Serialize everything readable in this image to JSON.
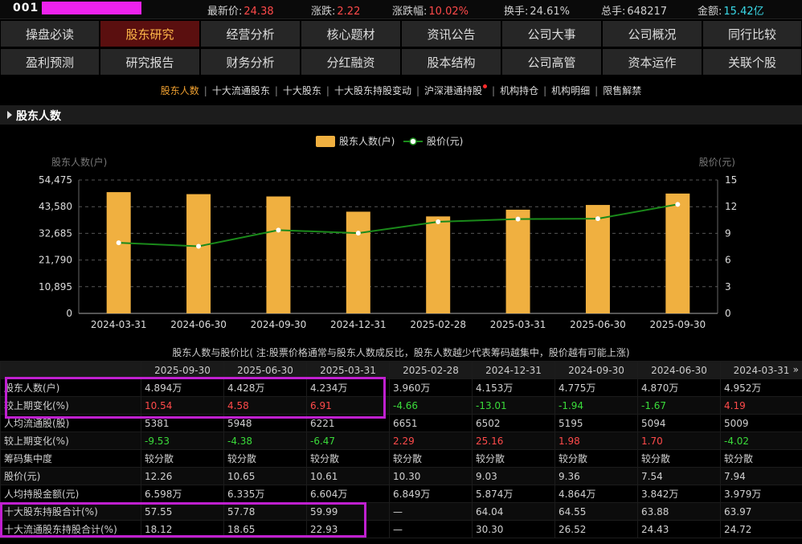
{
  "quote": {
    "code": "001",
    "items": [
      {
        "label": "最新价:",
        "value": "24.38",
        "cls": "val"
      },
      {
        "label": "涨跌:",
        "value": "2.22",
        "cls": "val"
      },
      {
        "label": "涨跌幅:",
        "value": "10.02%",
        "cls": "val"
      },
      {
        "label": "换手:",
        "value": "24.61%",
        "cls": "val nc"
      },
      {
        "label": "总手:",
        "value": "648217",
        "cls": "val nc"
      },
      {
        "label": "金额:",
        "value": "15.42亿",
        "cls": "val cyan"
      }
    ]
  },
  "nav": {
    "row1": [
      "操盘必读",
      "股东研究",
      "经营分析",
      "核心题材",
      "资讯公告",
      "公司大事",
      "公司概况",
      "同行比较"
    ],
    "row2": [
      "盈利预测",
      "研究报告",
      "财务分析",
      "分红融资",
      "股本结构",
      "公司高管",
      "资本运作",
      "关联个股"
    ],
    "active": "股东研究"
  },
  "subtabs": {
    "items": [
      "股东人数",
      "十大流通股东",
      "十大股东",
      "十大股东持股变动",
      "沪深港通持股",
      "机构持仓",
      "机构明细",
      "限售解禁"
    ],
    "active": "股东人数"
  },
  "section": {
    "title": "股东人数"
  },
  "chart_data": {
    "type": "bar+line",
    "categories": [
      "2024-03-31",
      "2024-06-30",
      "2024-09-30",
      "2024-12-31",
      "2025-02-28",
      "2025-03-31",
      "2025-06-30",
      "2025-09-30"
    ],
    "series": [
      {
        "name": "股东人数(户)",
        "type": "bar",
        "axis": "left",
        "values": [
          49520,
          48700,
          47750,
          41530,
          39600,
          42340,
          44280,
          48940
        ],
        "color": "#f0b040"
      },
      {
        "name": "股价(元)",
        "type": "line",
        "axis": "right",
        "values": [
          7.94,
          7.54,
          9.36,
          9.03,
          10.3,
          10.61,
          10.65,
          12.26
        ],
        "color": "#1a8a1a"
      }
    ],
    "ylabel_left": "股东人数(户)",
    "ylabel_right": "股价(元)",
    "yticks_left": [
      "54,475",
      "43,580",
      "32,685",
      "21,790",
      "10,895",
      "0"
    ],
    "yticks_right": [
      "15",
      "12",
      "9",
      "6",
      "3",
      "0"
    ],
    "ylim_left": [
      0,
      54475
    ],
    "ylim_right": [
      0,
      15
    ],
    "grid": true,
    "legend_position": "top-center"
  },
  "table": {
    "caption": "股东人数与股价比( 注:股票价格通常与股东人数成反比，股东人数越少代表筹码越集中，股价越有可能上涨)",
    "headers": [
      "",
      "2025-09-30",
      "2025-06-30",
      "2025-03-31",
      "2025-02-28",
      "2024-12-31",
      "2024-09-30",
      "2024-06-30",
      "2024-03-31"
    ],
    "more": "»",
    "rows": [
      {
        "label": "股东人数(户)",
        "cells": [
          "4.894万",
          "4.428万",
          "4.234万",
          "3.960万",
          "4.153万",
          "4.775万",
          "4.870万",
          "4.952万"
        ],
        "colors": [
          "nc",
          "nc",
          "nc",
          "nc",
          "nc",
          "nc",
          "nc",
          "nc"
        ]
      },
      {
        "label": "较上期变化(%)",
        "cells": [
          "10.54",
          "4.58",
          "6.91",
          "-4.66",
          "-13.01",
          "-1.94",
          "-1.67",
          "4.19"
        ],
        "colors": [
          "up",
          "up",
          "up",
          "down",
          "down",
          "down",
          "down",
          "up"
        ]
      },
      {
        "label": "人均流通股(股)",
        "cells": [
          "5381",
          "5948",
          "6221",
          "6651",
          "6502",
          "5195",
          "5094",
          "5009"
        ],
        "colors": [
          "nc",
          "nc",
          "nc",
          "nc",
          "nc",
          "nc",
          "nc",
          "nc"
        ]
      },
      {
        "label": "较上期变化(%)",
        "cells": [
          "-9.53",
          "-4.38",
          "-6.47",
          "2.29",
          "25.16",
          "1.98",
          "1.70",
          "-4.02"
        ],
        "colors": [
          "down",
          "down",
          "down",
          "up",
          "up",
          "up",
          "up",
          "down"
        ]
      },
      {
        "label": "筹码集中度",
        "cells": [
          "较分散",
          "较分散",
          "较分散",
          "较分散",
          "较分散",
          "较分散",
          "较分散",
          "较分散"
        ],
        "colors": [
          "nc",
          "nc",
          "nc",
          "nc",
          "nc",
          "nc",
          "nc",
          "nc"
        ]
      },
      {
        "label": "股价(元)",
        "cells": [
          "12.26",
          "10.65",
          "10.61",
          "10.30",
          "9.03",
          "9.36",
          "7.54",
          "7.94"
        ],
        "colors": [
          "nc",
          "nc",
          "nc",
          "nc",
          "nc",
          "nc",
          "nc",
          "nc"
        ]
      },
      {
        "label": "人均持股金额(元)",
        "cells": [
          "6.598万",
          "6.335万",
          "6.604万",
          "6.849万",
          "5.874万",
          "4.864万",
          "3.842万",
          "3.979万"
        ],
        "colors": [
          "nc",
          "nc",
          "nc",
          "nc",
          "nc",
          "nc",
          "nc",
          "nc"
        ]
      },
      {
        "label": "十大股东持股合计(%)",
        "cells": [
          "57.55",
          "57.78",
          "59.99",
          "—",
          "64.04",
          "64.55",
          "63.88",
          "63.97"
        ],
        "colors": [
          "nc",
          "nc",
          "nc",
          "nc",
          "nc",
          "nc",
          "nc",
          "nc"
        ]
      },
      {
        "label": "十大流通股东持股合计(%)",
        "cells": [
          "18.12",
          "18.65",
          "22.93",
          "—",
          "30.30",
          "26.52",
          "24.43",
          "24.72"
        ],
        "colors": [
          "nc",
          "nc",
          "nc",
          "nc",
          "nc",
          "nc",
          "nc",
          "nc"
        ]
      }
    ]
  }
}
